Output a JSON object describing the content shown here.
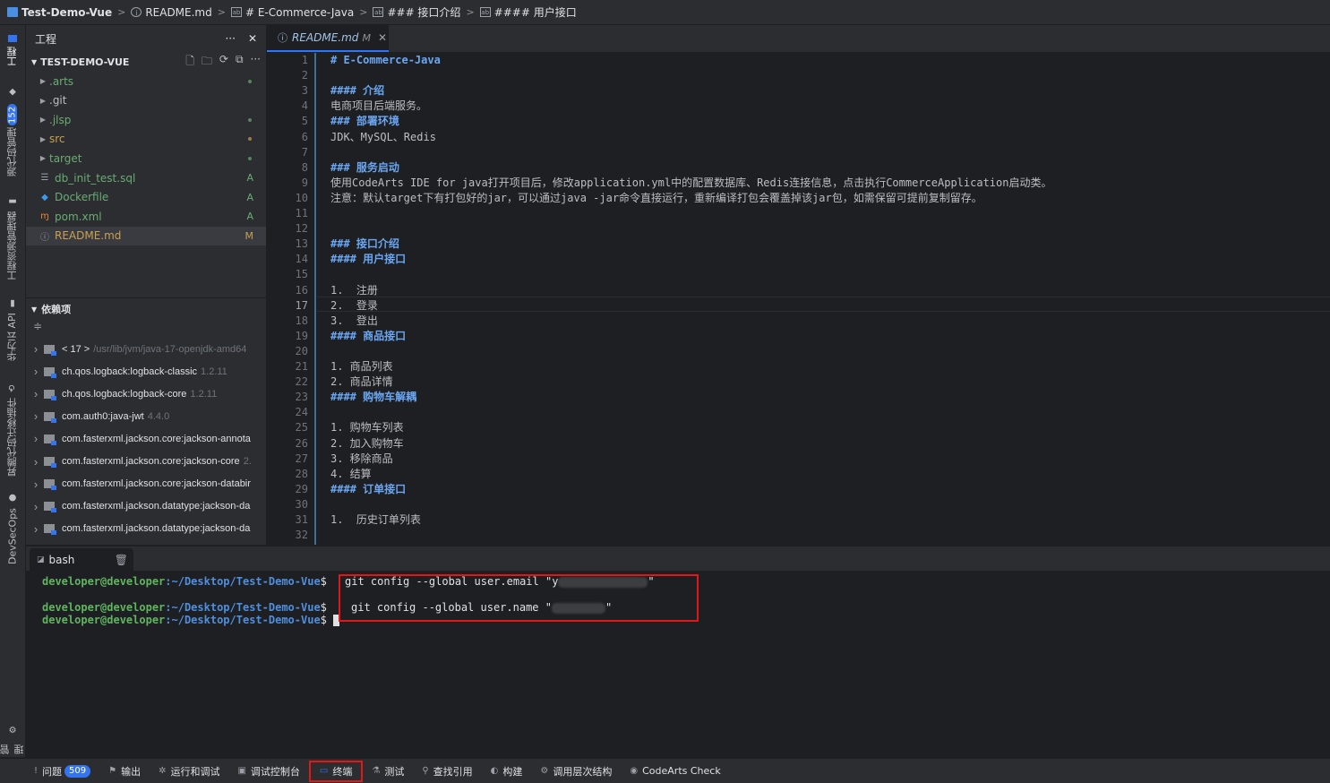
{
  "breadcrumb": {
    "items": [
      {
        "label": "Test-Demo-Vue",
        "icon": "folder-icon"
      },
      {
        "label": "README.md",
        "icon": "info-icon"
      },
      {
        "label": "# E-Commerce-Java",
        "icon": "markdown-heading-icon"
      },
      {
        "label": "### 接口介绍",
        "icon": "markdown-heading-icon"
      },
      {
        "label": "#### 用户接口",
        "icon": "markdown-heading-icon"
      }
    ],
    "separator": ">"
  },
  "rail": {
    "project_label": "工程",
    "scm_label": "源代码管理",
    "scm_count": "152",
    "explorer_label": "工程资源管理器",
    "api_label": "华为云 API",
    "migrate_label": "昇腾代码迁移插件",
    "devsecops_label": "DevSecOps",
    "manage_label": "管理"
  },
  "explorer": {
    "title": "工程",
    "more": "···",
    "close": "✕",
    "project_name": "TEST-DEMO-VUE",
    "tools": [
      "new-file-icon",
      "new-folder-icon",
      "refresh-icon",
      "collapse-icon",
      "more-icon"
    ],
    "tool_glyphs": [
      "🗋",
      "🗀",
      "⟳",
      "⧉",
      "···"
    ],
    "files": [
      {
        "name": ".arts",
        "type": "folder",
        "status": "",
        "color": "#6aab73"
      },
      {
        "name": ".git",
        "type": "folder",
        "status": "",
        "color": "#bcbec4"
      },
      {
        "name": ".jlsp",
        "type": "folder",
        "status": "",
        "color": "#6aab73"
      },
      {
        "name": "src",
        "type": "folder",
        "status": "",
        "color": "#c9a150"
      },
      {
        "name": "target",
        "type": "folder",
        "status": "",
        "color": "#6aab73"
      },
      {
        "name": "db_init_test.sql",
        "type": "file",
        "status": "A",
        "color": "#6aab73"
      },
      {
        "name": "Dockerfile",
        "type": "file",
        "status": "A",
        "color": "#6aab73"
      },
      {
        "name": "pom.xml",
        "type": "file",
        "status": "A",
        "color": "#6aab73"
      },
      {
        "name": "README.md",
        "type": "file",
        "status": "M",
        "color": "#c9a150"
      }
    ],
    "deps_title": "依赖项",
    "deps": [
      {
        "name": "< 17 >",
        "version": "/usr/lib/jvm/java-17-openjdk-amd64"
      },
      {
        "name": "ch.qos.logback:logback-classic",
        "version": "1.2.11"
      },
      {
        "name": "ch.qos.logback:logback-core",
        "version": "1.2.11"
      },
      {
        "name": "com.auth0:java-jwt",
        "version": "4.4.0"
      },
      {
        "name": "com.fasterxml.jackson.core:jackson-annota",
        "version": ""
      },
      {
        "name": "com.fasterxml.jackson.core:jackson-core",
        "version": "2."
      },
      {
        "name": "com.fasterxml.jackson.core:jackson-databir",
        "version": ""
      },
      {
        "name": "com.fasterxml.jackson.datatype:jackson-da",
        "version": ""
      },
      {
        "name": "com.fasterxml.jackson.datatype:jackson-da",
        "version": ""
      }
    ]
  },
  "editor": {
    "tab_label": "README.md",
    "tab_modified": "M",
    "tab_close": "✕",
    "current_line": 17,
    "lines": [
      {
        "n": "1",
        "text": "# E-Commerce-Java",
        "heading": true
      },
      {
        "n": "2",
        "text": "",
        "heading": false
      },
      {
        "n": "3",
        "text": "#### 介绍",
        "heading": true
      },
      {
        "n": "4",
        "text": "电商项目后端服务。",
        "heading": false
      },
      {
        "n": "5",
        "text": "### 部署环境",
        "heading": true
      },
      {
        "n": "6",
        "text": "JDK、MySQL、Redis",
        "heading": false
      },
      {
        "n": "7",
        "text": "",
        "heading": false
      },
      {
        "n": "8",
        "text": "### 服务启动",
        "heading": true
      },
      {
        "n": "9",
        "text": "使用CodeArts IDE for java打开项目后，修改application.yml中的配置数据库、Redis连接信息，点击执行CommerceApplication启动类。",
        "heading": false
      },
      {
        "n": "10",
        "text": "注意：默认target下有打包好的jar，可以通过java -jar命令直接运行，重新编译打包会覆盖掉该jar包，如需保留可提前复制留存。",
        "heading": false
      },
      {
        "n": "11",
        "text": "",
        "heading": false
      },
      {
        "n": "12",
        "text": "",
        "heading": false
      },
      {
        "n": "13",
        "text": "### 接口介绍",
        "heading": true
      },
      {
        "n": "14",
        "text": "#### 用户接口",
        "heading": true
      },
      {
        "n": "15",
        "text": "",
        "heading": false
      },
      {
        "n": "16",
        "text": "1.  注册",
        "heading": false
      },
      {
        "n": "17",
        "text": "2.  登录",
        "heading": false
      },
      {
        "n": "18",
        "text": "3.  登出",
        "heading": false
      },
      {
        "n": "19",
        "text": "#### 商品接口",
        "heading": true
      },
      {
        "n": "20",
        "text": "",
        "heading": false
      },
      {
        "n": "21",
        "text": "1. 商品列表",
        "heading": false
      },
      {
        "n": "22",
        "text": "2. 商品详情",
        "heading": false
      },
      {
        "n": "23",
        "text": "#### 购物车解耦",
        "heading": true
      },
      {
        "n": "24",
        "text": "",
        "heading": false
      },
      {
        "n": "25",
        "text": "1. 购物车列表",
        "heading": false
      },
      {
        "n": "26",
        "text": "2. 加入购物车",
        "heading": false
      },
      {
        "n": "27",
        "text": "3. 移除商品",
        "heading": false
      },
      {
        "n": "28",
        "text": "4. 结算",
        "heading": false
      },
      {
        "n": "29",
        "text": "#### 订单接口",
        "heading": true
      },
      {
        "n": "30",
        "text": "",
        "heading": false
      },
      {
        "n": "31",
        "text": "1.  历史订单列表",
        "heading": false
      },
      {
        "n": "32",
        "text": "",
        "heading": false
      }
    ]
  },
  "terminal": {
    "tab_label": "bash",
    "prompt_user": "developer@developer",
    "prompt_path": ":~/Desktop/Test-Demo-Vue",
    "prompt_dollar": "$",
    "cmd1_prefix": "git config --global user.email \"y",
    "cmd1_suffix": "\"",
    "cmd2_prefix": "git config --global user.name \"",
    "cmd2_suffix": "\""
  },
  "statusbar": {
    "items": [
      {
        "label": "问题",
        "badge": "509",
        "icon": "problems-icon",
        "glyph": "!"
      },
      {
        "label": "输出",
        "badge": "",
        "icon": "output-icon",
        "glyph": "⚑"
      },
      {
        "label": "运行和调试",
        "badge": "",
        "icon": "run-debug-icon",
        "glyph": "✲"
      },
      {
        "label": "调试控制台",
        "badge": "",
        "icon": "debug-console-icon",
        "glyph": "▣"
      },
      {
        "label": "终端",
        "badge": "",
        "icon": "terminal-icon",
        "glyph": "▭"
      },
      {
        "label": "测试",
        "badge": "",
        "icon": "test-icon",
        "glyph": "⚗"
      },
      {
        "label": "查找引用",
        "badge": "",
        "icon": "find-references-icon",
        "glyph": "⚲"
      },
      {
        "label": "构建",
        "badge": "",
        "icon": "build-icon",
        "glyph": "◐"
      },
      {
        "label": "调用层次结构",
        "badge": "",
        "icon": "call-hierarchy-icon",
        "glyph": "⚙"
      },
      {
        "label": "CodeArts Check",
        "badge": "",
        "icon": "codearts-check-icon",
        "glyph": "◉"
      }
    ]
  },
  "colors": {
    "accent": "#3574f0",
    "highlight_box": "#e01818",
    "heading": "#6aa6f2",
    "prompt_user": "#5fb65f",
    "prompt_path": "#4f8fdf"
  }
}
